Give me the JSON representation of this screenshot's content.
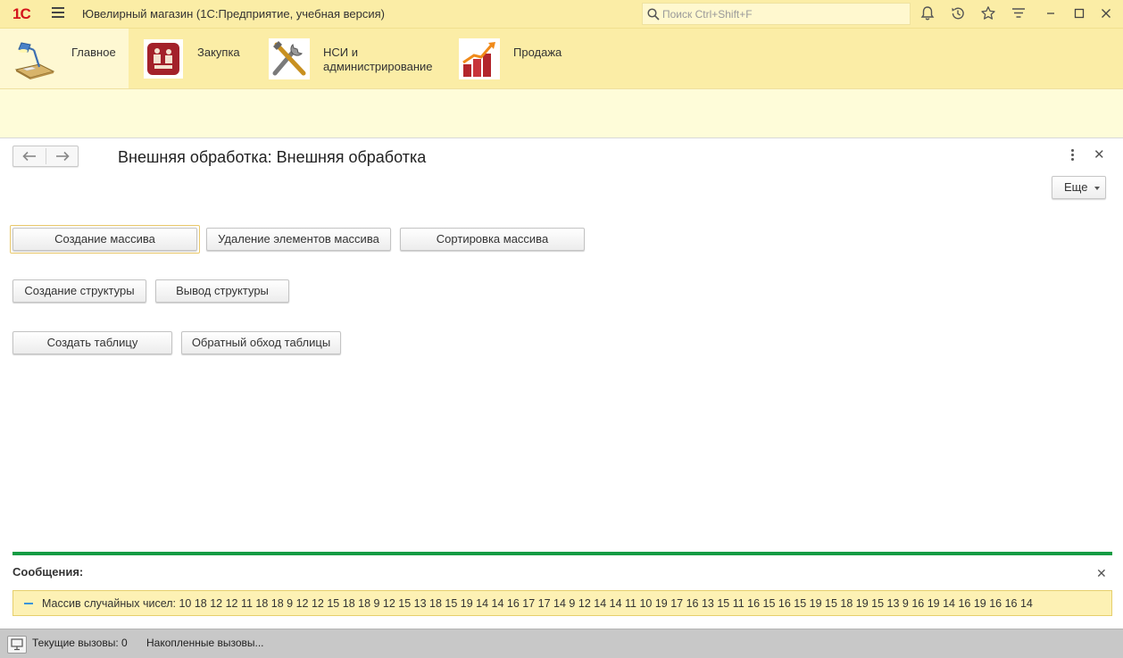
{
  "titlebar": {
    "logo": "1С",
    "title": "Ювелирный магазин  (1С:Предприятие, учебная версия)",
    "search_placeholder": "Поиск Ctrl+Shift+F"
  },
  "sections": [
    {
      "label": "Главное",
      "active": true
    },
    {
      "label": "Закупка",
      "active": false
    },
    {
      "label": "НСИ и\nадминистрирование",
      "active": false
    },
    {
      "label": "Продажа",
      "active": false
    }
  ],
  "form": {
    "title": "Внешняя обработка: Внешняя обработка",
    "more_label": "Еще"
  },
  "buttons": {
    "create_array": "Создание массива",
    "delete_array_elements": "Удаление элементов массива",
    "sort_array": "Сортировка массива",
    "create_structure": "Создание структуры",
    "output_structure": "Вывод структуры",
    "create_table": "Создать таблицу",
    "reverse_table": "Обратный обход таблицы"
  },
  "messages": {
    "title": "Сообщения:",
    "items": [
      "Массив случайных чисел: 10 18 12 12 11 18 18 9 12 12 15 18 18 9 12 15 13 18 15 19 14 14 16 17 17 14 9 12 14 14 11 10 19 17 16 13 15 11 16 15 16 15 19 15 18 19 15 13 9 16 19 14 16 19 16 16 14"
    ]
  },
  "statusbar": {
    "current_calls": "Текущие вызовы: 0",
    "accumulated_calls": "Накопленные вызовы..."
  },
  "colors": {
    "header_bg": "#fbeda6",
    "active_section_bg": "#fef8d2",
    "accent_green": "#129c44",
    "logo_red": "#d4161c"
  }
}
